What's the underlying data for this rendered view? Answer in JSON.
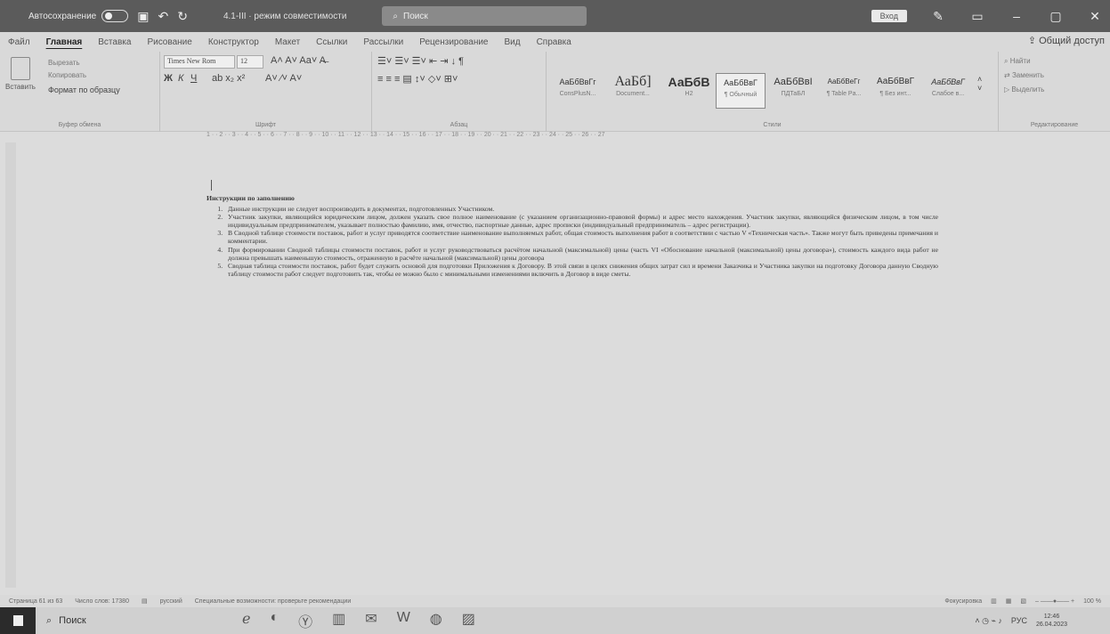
{
  "titlebar": {
    "autosave": "Автосохранение",
    "doc_title": "4.1-III · режим совместимости",
    "search": "Поиск",
    "signin": "Вход"
  },
  "menu": {
    "tabs": [
      "Файл",
      "Главная",
      "Вставка",
      "Рисование",
      "Конструктор",
      "Макет",
      "Ссылки",
      "Рассылки",
      "Рецензирование",
      "Вид",
      "Справка"
    ],
    "share": "Общий доступ"
  },
  "ribbon": {
    "clipboard": {
      "paste": "Вставить",
      "cut": "Вырезать",
      "copy": "Копировать",
      "format_painter": "Формат по образцу",
      "label": "Буфер обмена"
    },
    "font": {
      "name": "Times New Rom",
      "size": "12",
      "label": "Шрифт"
    },
    "paragraph": {
      "label": "Абзац"
    },
    "styles": {
      "items": [
        {
          "preview": "АаБбВвГг",
          "name": "ConsPlusN..."
        },
        {
          "preview": "АаБб]",
          "name": "Document..."
        },
        {
          "preview": "АаБбВ",
          "name": "H2"
        },
        {
          "preview": "АаБбВвГ",
          "name": "¶ Обычный"
        },
        {
          "preview": "АаБбВвІ",
          "name": "ПДТаБЛ"
        },
        {
          "preview": "АаБбВеГг",
          "name": "¶ Table Pa..."
        },
        {
          "preview": "АаБбВвГ",
          "name": "¶ Без инт..."
        },
        {
          "preview": "АаБбВвГ",
          "name": "Слабое в..."
        }
      ],
      "label": "Стили"
    },
    "editing": {
      "find": "Найти",
      "replace": "Заменить",
      "select": "Выделить",
      "label": "Редактирование"
    }
  },
  "document": {
    "heading": "Инструкции по заполнению",
    "items": [
      "Данные инструкции не следует воспроизводить в документах, подготовленных Участником.",
      "Участник закупки, являющийся юридическим лицом, должен указать свое полное наименование (с указанием организационно-правовой формы) и адрес место нахождения. Участник закупки, являющийся физическим лицом, в том числе индивидуальным предпринимателем, указывает полностью фамилию, имя, отчество, паспортные данные, адрес прописки (индивидуальный предприниматель – адрес регистрации).",
      "В Сводной таблице стоимости поставок, работ и услуг приводятся соответствие наименование выполняемых работ, общая стоимость выполнения работ в соответствии с частью V «Техническая часть». Также могут быть приведены примечания и комментарии.",
      "При формировании Сводной таблицы стоимости поставок, работ и услуг руководствоваться расчётом начальной (максимальной) цены (часть VI «Обоснование начальной (максимальной) цены договора»), стоимость каждого вида работ не должна превышать наименьшую стоимость, отраженную в расчёте начальной (максимальной) цены договора",
      "Сводная таблица стоимости поставок, работ будет служить основой для подготовки Приложения к Договору. В этой связи в целях снижения общих затрат сил и времени Заказчика и Участника закупки на подготовку Договора данную Сводную таблицу стоимости работ следует подготовить так, чтобы ее можно было с минимальными изменениями включить в Договор в виде сметы."
    ]
  },
  "statusbar": {
    "page": "Страница 61 из 63",
    "words": "Число слов: 17380",
    "language": "русский",
    "accessibility": "Специальные возможности: проверьте рекомендации",
    "focus": "Фокусировка",
    "zoom": "100 %"
  },
  "taskbar": {
    "search": "Поиск",
    "lang": "РУС",
    "time": "12:46",
    "date": "26.04.2023"
  }
}
